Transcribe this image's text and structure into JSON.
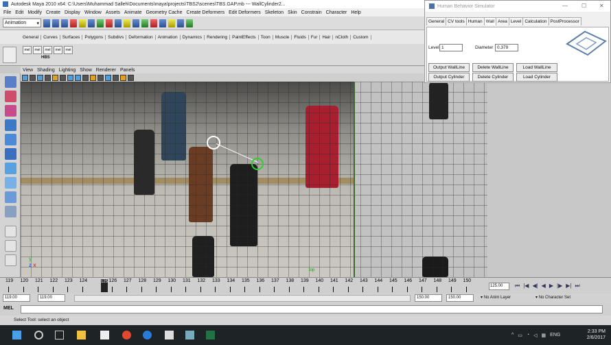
{
  "window": {
    "title": "Autodesk Maya 2010 x64: C:\\Users\\Muhammad Salleh\\Documents\\maya\\projects\\TBS2\\scenes\\TBS.GAP.mb  ---  WallCylinder2..."
  },
  "menu": [
    "File",
    "Edit",
    "Modify",
    "Create",
    "Display",
    "Window",
    "Assets",
    "Animate",
    "Geometry Cache",
    "Create Deformers",
    "Edit Deformers",
    "Skeleton",
    "Skin",
    "Constrain",
    "Character",
    "Help"
  ],
  "status_line": {
    "mode": "Animation"
  },
  "shelf_tabs": [
    "General",
    "Curves",
    "Surfaces",
    "Polygons",
    "Subdivs",
    "Deformation",
    "Animation",
    "Dynamics",
    "Rendering",
    "PaintEffects",
    "Toon",
    "Muscle",
    "Fluids",
    "Fur",
    "Hair",
    "nCloth",
    "Custom"
  ],
  "shelf": {
    "mel_buttons": [
      "mel",
      "mel",
      "mel",
      "mel",
      "mel"
    ],
    "hbs_label": "HBS"
  },
  "panel_menu": [
    "View",
    "Shading",
    "Lighting",
    "Show",
    "Renderer",
    "Panels"
  ],
  "viewport": {
    "camera_label": "top",
    "axis": {
      "y": "y",
      "z": "z",
      "x": "x"
    }
  },
  "timeline": {
    "ticks": [
      "119",
      "120",
      "121",
      "122",
      "123",
      "124",
      "125",
      "126",
      "127",
      "128",
      "129",
      "130",
      "131",
      "132",
      "133",
      "134",
      "135",
      "136",
      "137",
      "138",
      "139",
      "140",
      "141",
      "142",
      "143",
      "144",
      "145",
      "146",
      "147",
      "148",
      "149",
      "150"
    ],
    "current_frame": "125",
    "current_frame_field": "125.00"
  },
  "range": {
    "start_outer": "119.00",
    "start_inner": "119.00",
    "end_inner": "150.00",
    "end_outer": "150.00",
    "anim_layer": "No Anim Layer",
    "character_set": "No Character Set"
  },
  "command_line": {
    "label": "MEL",
    "value": ""
  },
  "help_line": "Select Tool: select an object",
  "taskbar": {
    "time": "2:33 PM",
    "date": "2/6/2017",
    "lang": "ENG"
  },
  "plugin": {
    "title": "Human Behavior Simulator",
    "tabs": [
      "General",
      "CV tools",
      "Human",
      "Wall",
      "Area",
      "Level",
      "Calculation",
      "PostProcessor"
    ],
    "active_tab": "Wall",
    "level_label": "Level",
    "level_value": "1",
    "diameter_label": "Diameter",
    "diameter_value": "0.379",
    "buttons": {
      "output_wall": "Output WallLine",
      "delete_wall": "Delete WallLine",
      "load_wall": "Load WallLine",
      "output_cyl": "Output Cylinder",
      "delete_cyl": "Delete Cylinder",
      "load_cyl": "Load Cylinder"
    }
  },
  "colors": {
    "viewport_grid": "#282828",
    "wall_ring": "#ffffff",
    "cylinder_ring": "#33cc33",
    "timeline_current": "#222222",
    "taskbar": "#1e2326"
  }
}
